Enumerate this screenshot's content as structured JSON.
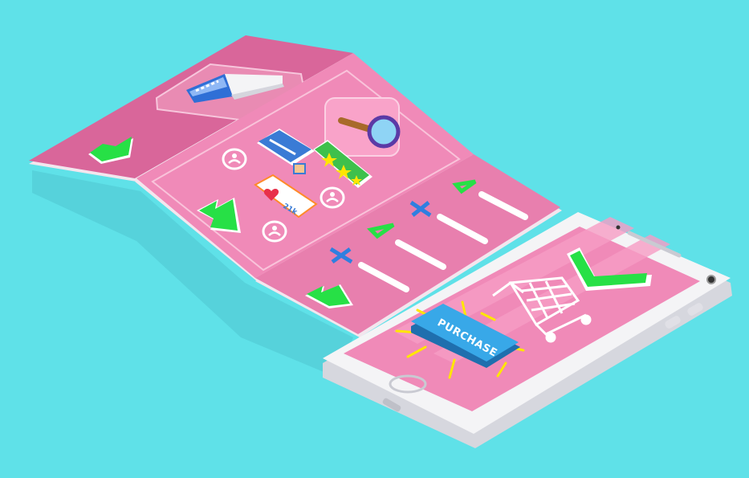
{
  "illustration": {
    "purchase_button_label": "PURCHASE",
    "likes_count": "21k"
  },
  "colors": {
    "background": "#5fe1e8",
    "panel_dark": "#d9669a",
    "panel_light": "#f08ab8",
    "panel_inner": "#f9a3c9",
    "arrow_green": "#27e046",
    "cross_blue": "#2f7fe0",
    "purchase_blue": "#38a8e8",
    "burst_yellow": "#ffe600",
    "phone_white": "#f4f4f6"
  },
  "icons": [
    "megaphone-icon",
    "magnifier-icon",
    "user-avatar-icon",
    "star-rating-icon",
    "heart-like-icon",
    "down-arrow-icon",
    "check-icon",
    "cross-icon",
    "shopping-cart-icon"
  ]
}
